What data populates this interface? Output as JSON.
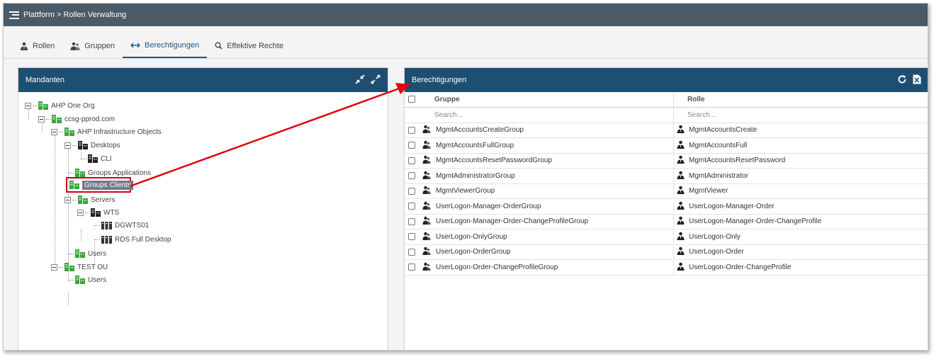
{
  "header": {
    "breadcrumb": "Plattform > Rollen Verwaltung"
  },
  "tabs": [
    {
      "label": "Rollen",
      "icon": "user-tie-icon"
    },
    {
      "label": "Gruppen",
      "icon": "user-group-icon"
    },
    {
      "label": "Berechtigungen",
      "icon": "arrows-left-right-icon",
      "active": true
    },
    {
      "label": "Effektive Rechte",
      "icon": "search-icon"
    }
  ],
  "left_panel": {
    "title": "Mandanten",
    "tree": [
      {
        "label": "AHP One Org"
      },
      {
        "label": "ccsg-pprod.com"
      },
      {
        "label": "AHP Infrastructure Objects"
      },
      {
        "label": "Desktops"
      },
      {
        "label": "CLI"
      },
      {
        "label": "Groups Applications"
      },
      {
        "label": "Groups Clients",
        "selected": true
      },
      {
        "label": "Servers"
      },
      {
        "label": "WTS"
      },
      {
        "label": "DGWTS01"
      },
      {
        "label": "RDS Full Desktop"
      },
      {
        "label": "Users"
      },
      {
        "label": "TEST OU"
      },
      {
        "label": "Users"
      }
    ]
  },
  "right_panel": {
    "title": "Berechtigungen",
    "columns": {
      "group": "Gruppe",
      "role": "Rolle"
    },
    "search_placeholder": "Search...",
    "rows": [
      {
        "group": "MgmtAccountsCreateGroup",
        "role": "MgmtAccountsCreate"
      },
      {
        "group": "MgmtAccountsFullGroup",
        "role": "MgmtAccountsFull"
      },
      {
        "group": "MgmtAccountsResetPasswordGroup",
        "role": "MgmtAccountsResetPassword"
      },
      {
        "group": "MgmtAdministratorGroup",
        "role": "MgmtAdministrator"
      },
      {
        "group": "MgmtViewerGroup",
        "role": "MgmtViewer"
      },
      {
        "group": "UserLogon-Manager-OrderGroup",
        "role": "UserLogon-Manager-Order"
      },
      {
        "group": "UserLogon-Manager-Order-ChangeProfileGroup",
        "role": "UserLogon-Manager-Order-ChangeProfile"
      },
      {
        "group": "UserLogon-OnlyGroup",
        "role": "UserLogon-Only"
      },
      {
        "group": "UserLogon-OrderGroup",
        "role": "UserLogon-Order"
      },
      {
        "group": "UserLogon-Order-ChangeProfileGroup",
        "role": "UserLogon-Order-ChangeProfile"
      }
    ]
  },
  "colors": {
    "header_bar": "#4a5a66",
    "panel_header": "#1d4f73",
    "accent": "#1c5a86",
    "org_icon": "#3aa63a",
    "highlight": "#d0021b"
  }
}
